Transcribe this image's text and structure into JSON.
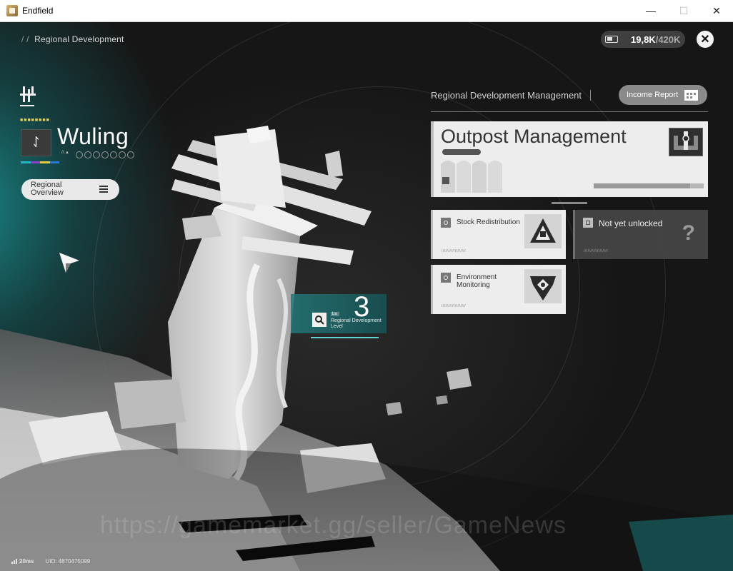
{
  "window": {
    "title": "Endfield",
    "minimize_glyph": "—",
    "maximize_glyph": "☐",
    "close_glyph": "✕"
  },
  "hud": {
    "breadcrumb_prefix": "/ /",
    "breadcrumb": "Regional Development",
    "currency_value": "19,8K",
    "currency_max": "/420K",
    "close_glyph": "✕"
  },
  "region": {
    "dots": "■■■■■■■■",
    "icon_glyph": "ᛇ",
    "name": "Wuling",
    "sublabel": "//.▲",
    "progress_circles": 7,
    "colorbar": [
      "#1fb7c6",
      "#8a3fd0",
      "#e6c93a",
      "#2a7bd6"
    ]
  },
  "overview_button": {
    "label": "Regional Overview"
  },
  "level": {
    "lv_label": "Lv.",
    "caption": "Regional Development Level",
    "value": "3"
  },
  "management": {
    "title": "Regional Development Management",
    "income_report": "Income Report",
    "outpost": {
      "title": "Outpost Management",
      "tag": "/////////////"
    },
    "cards": [
      {
        "label": "Stock Redistribution",
        "footer": "//////////////////",
        "locked": false
      },
      {
        "label": "Not yet unlocked",
        "footer": "//////////////////",
        "locked": true,
        "glyph": "?"
      },
      {
        "label": "Environment Monitoring",
        "footer": "//////////////////",
        "locked": false
      }
    ]
  },
  "status": {
    "ping": "20ms",
    "uid": "UID: 4870475099"
  },
  "watermark": "https://gamemarket.gg/seller/GameNews",
  "colors": {
    "accent_teal": "#1a9496",
    "card_bg": "#ededed",
    "locked_bg": "#464646"
  }
}
